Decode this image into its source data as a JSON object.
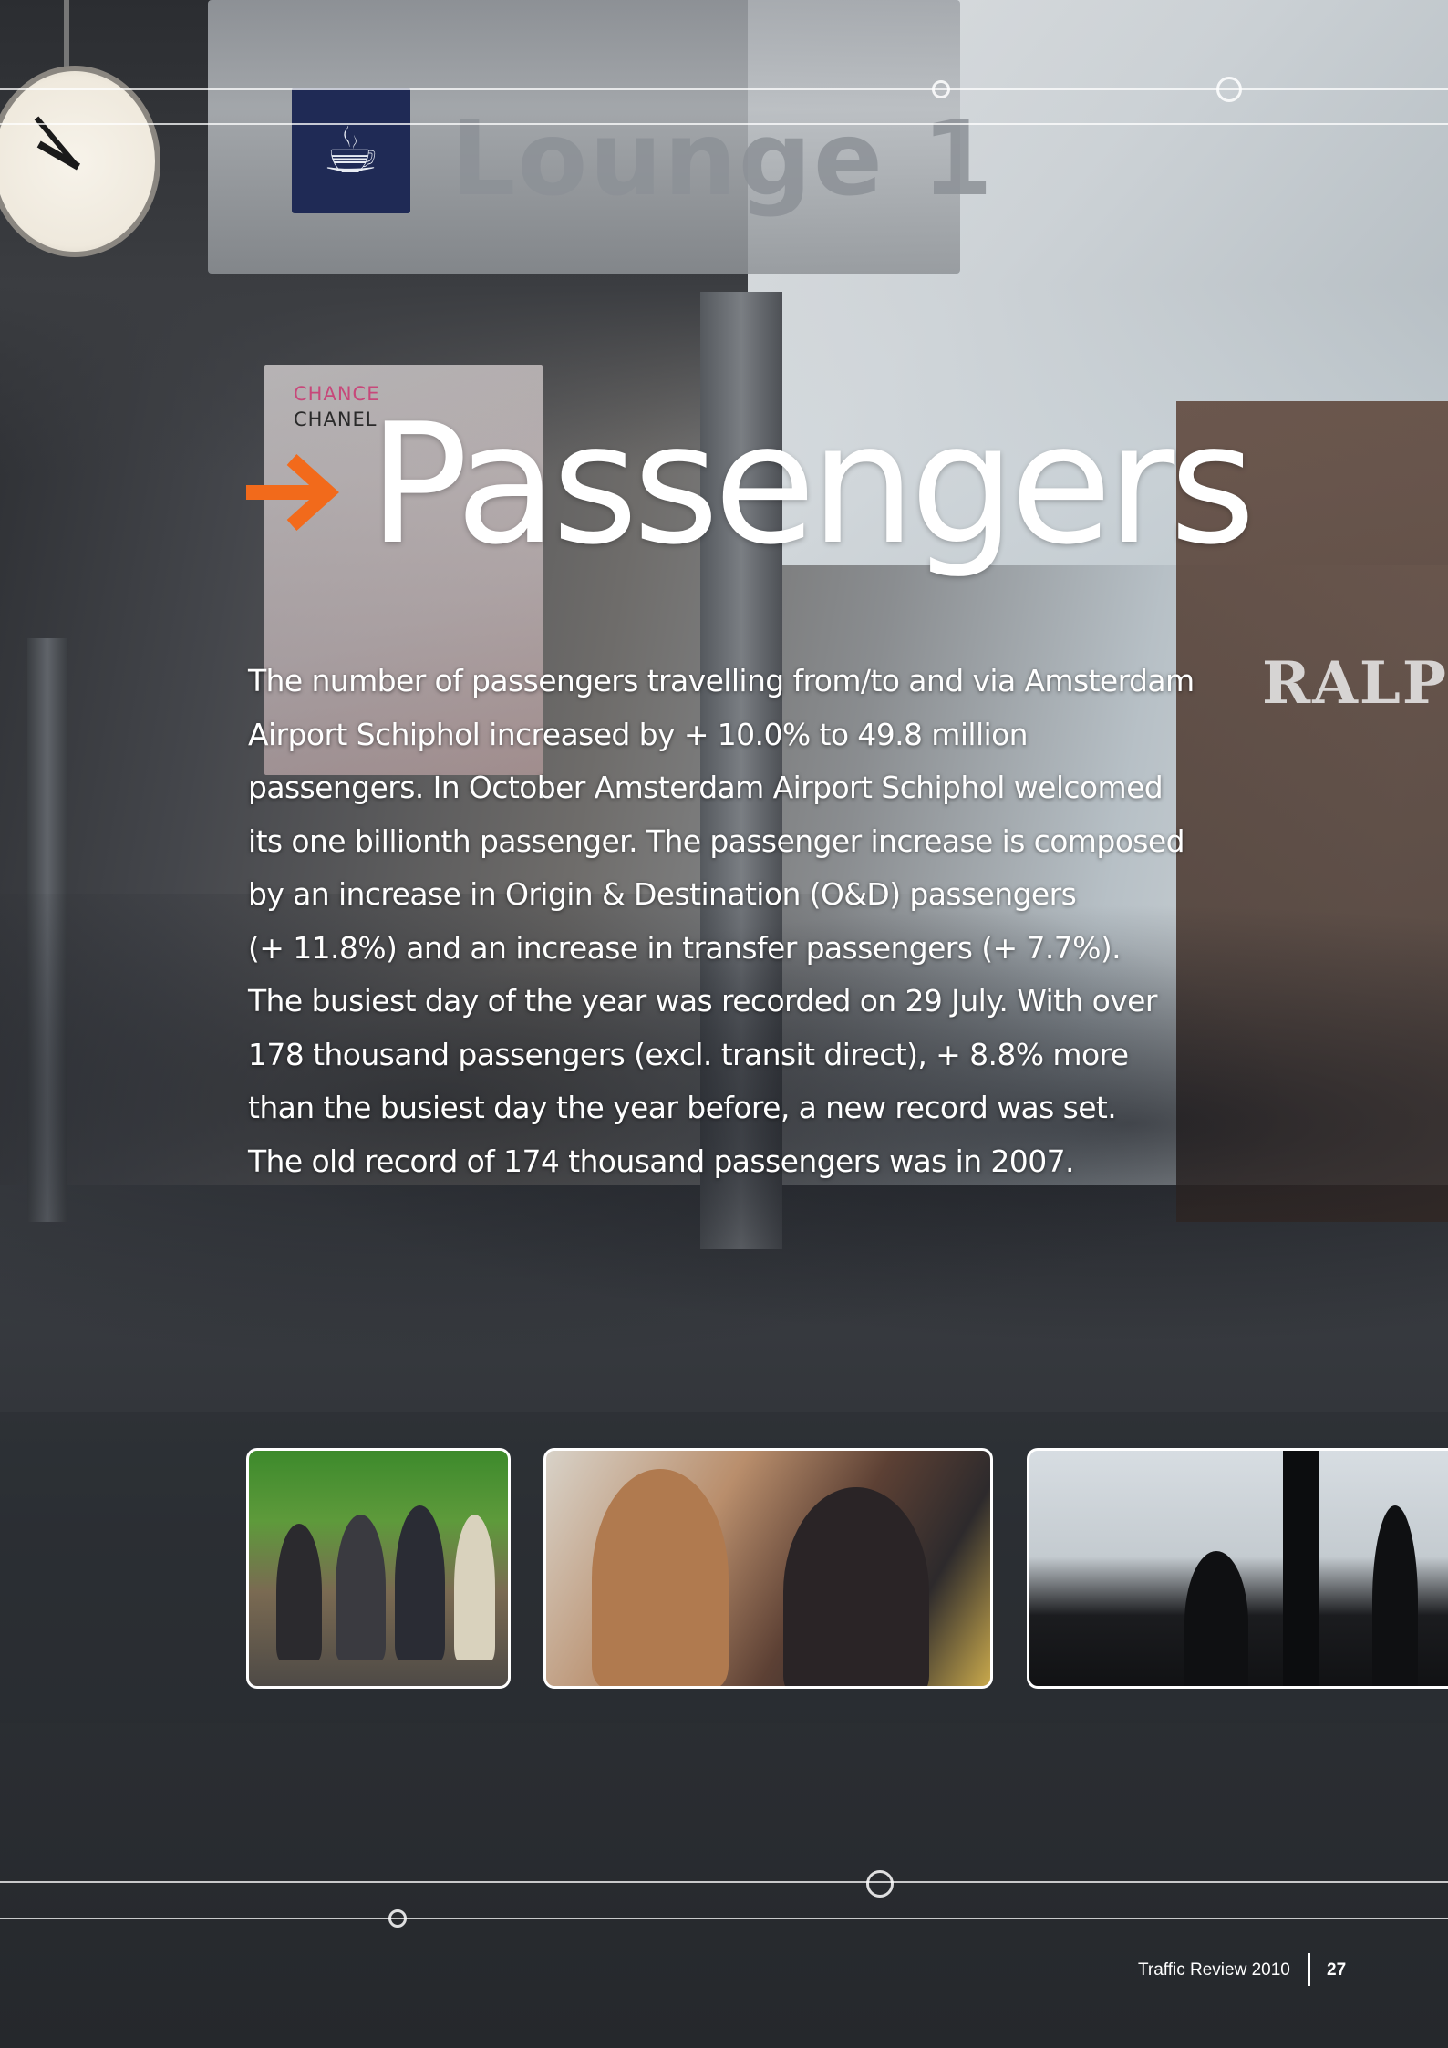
{
  "background": {
    "sign_text": "Lounge 1",
    "poster_brand_top": "CHANCE",
    "poster_brand_bottom": "CHANEL",
    "shop_text": "RALPH",
    "sign_icon": "lounge-pictogram-icon",
    "clock_icon": "wall-clock-icon"
  },
  "heading": {
    "arrow_icon": "arrow-right-icon",
    "arrow_color": "#f26a1b",
    "title": "Passengers"
  },
  "body": {
    "lines": [
      "The number of passengers travelling from/to and via Amsterdam",
      "Airport Schiphol increased by + 10.0% to 49.8 million",
      "passengers. In October Amsterdam Airport Schiphol welcomed",
      "its one billionth passenger. The passenger increase is composed",
      "by an increase in Origin & Destination (O&D) passengers",
      "(+ 11.8%) and an increase in transfer passengers (+ 7.7%).",
      "The busiest day of the year was recorded on 29 July. With over",
      "178 thousand passengers (excl. transit direct), + 8.8% more",
      "than the busiest day the year before, a new record was set.",
      "The old record of 174 thousand passengers was in 2007."
    ]
  },
  "photos": [
    {
      "subject": "passengers-seated-photo"
    },
    {
      "subject": "shopping-counter-photo"
    },
    {
      "subject": "departure-gate-silhouette-photo"
    }
  ],
  "footer": {
    "publication": "Traffic Review 2010",
    "page_number": "27"
  }
}
